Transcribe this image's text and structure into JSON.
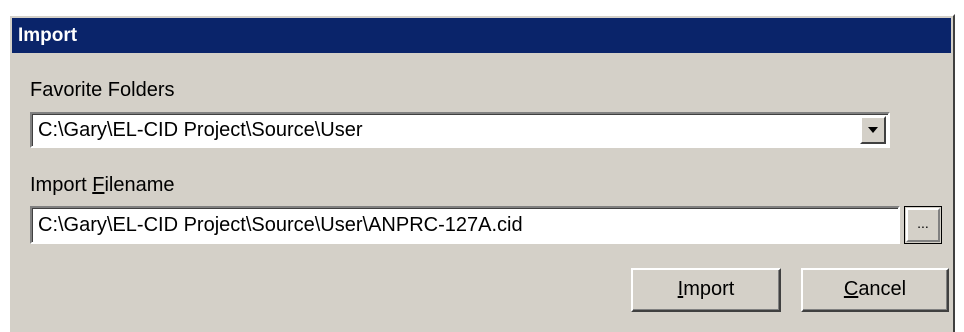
{
  "window": {
    "title": "Import"
  },
  "favorites": {
    "label": "Favorite Folders",
    "value": "C:\\Gary\\EL-CID Project\\Source\\User"
  },
  "filename": {
    "label_prefix": "Import ",
    "label_mnemonic": "F",
    "label_rest": "ilename",
    "value": "C:\\Gary\\EL-CID Project\\Source\\User\\ANPRC-127A.cid",
    "browse_label": "..."
  },
  "buttons": {
    "import_mnemonic": "I",
    "import_rest": "mport",
    "cancel_mnemonic": "C",
    "cancel_rest": "ancel"
  },
  "colors": {
    "titlebar": "#0a246a",
    "face": "#d4d0c8"
  },
  "icons": {
    "dropdown": "chevron-down-icon"
  }
}
